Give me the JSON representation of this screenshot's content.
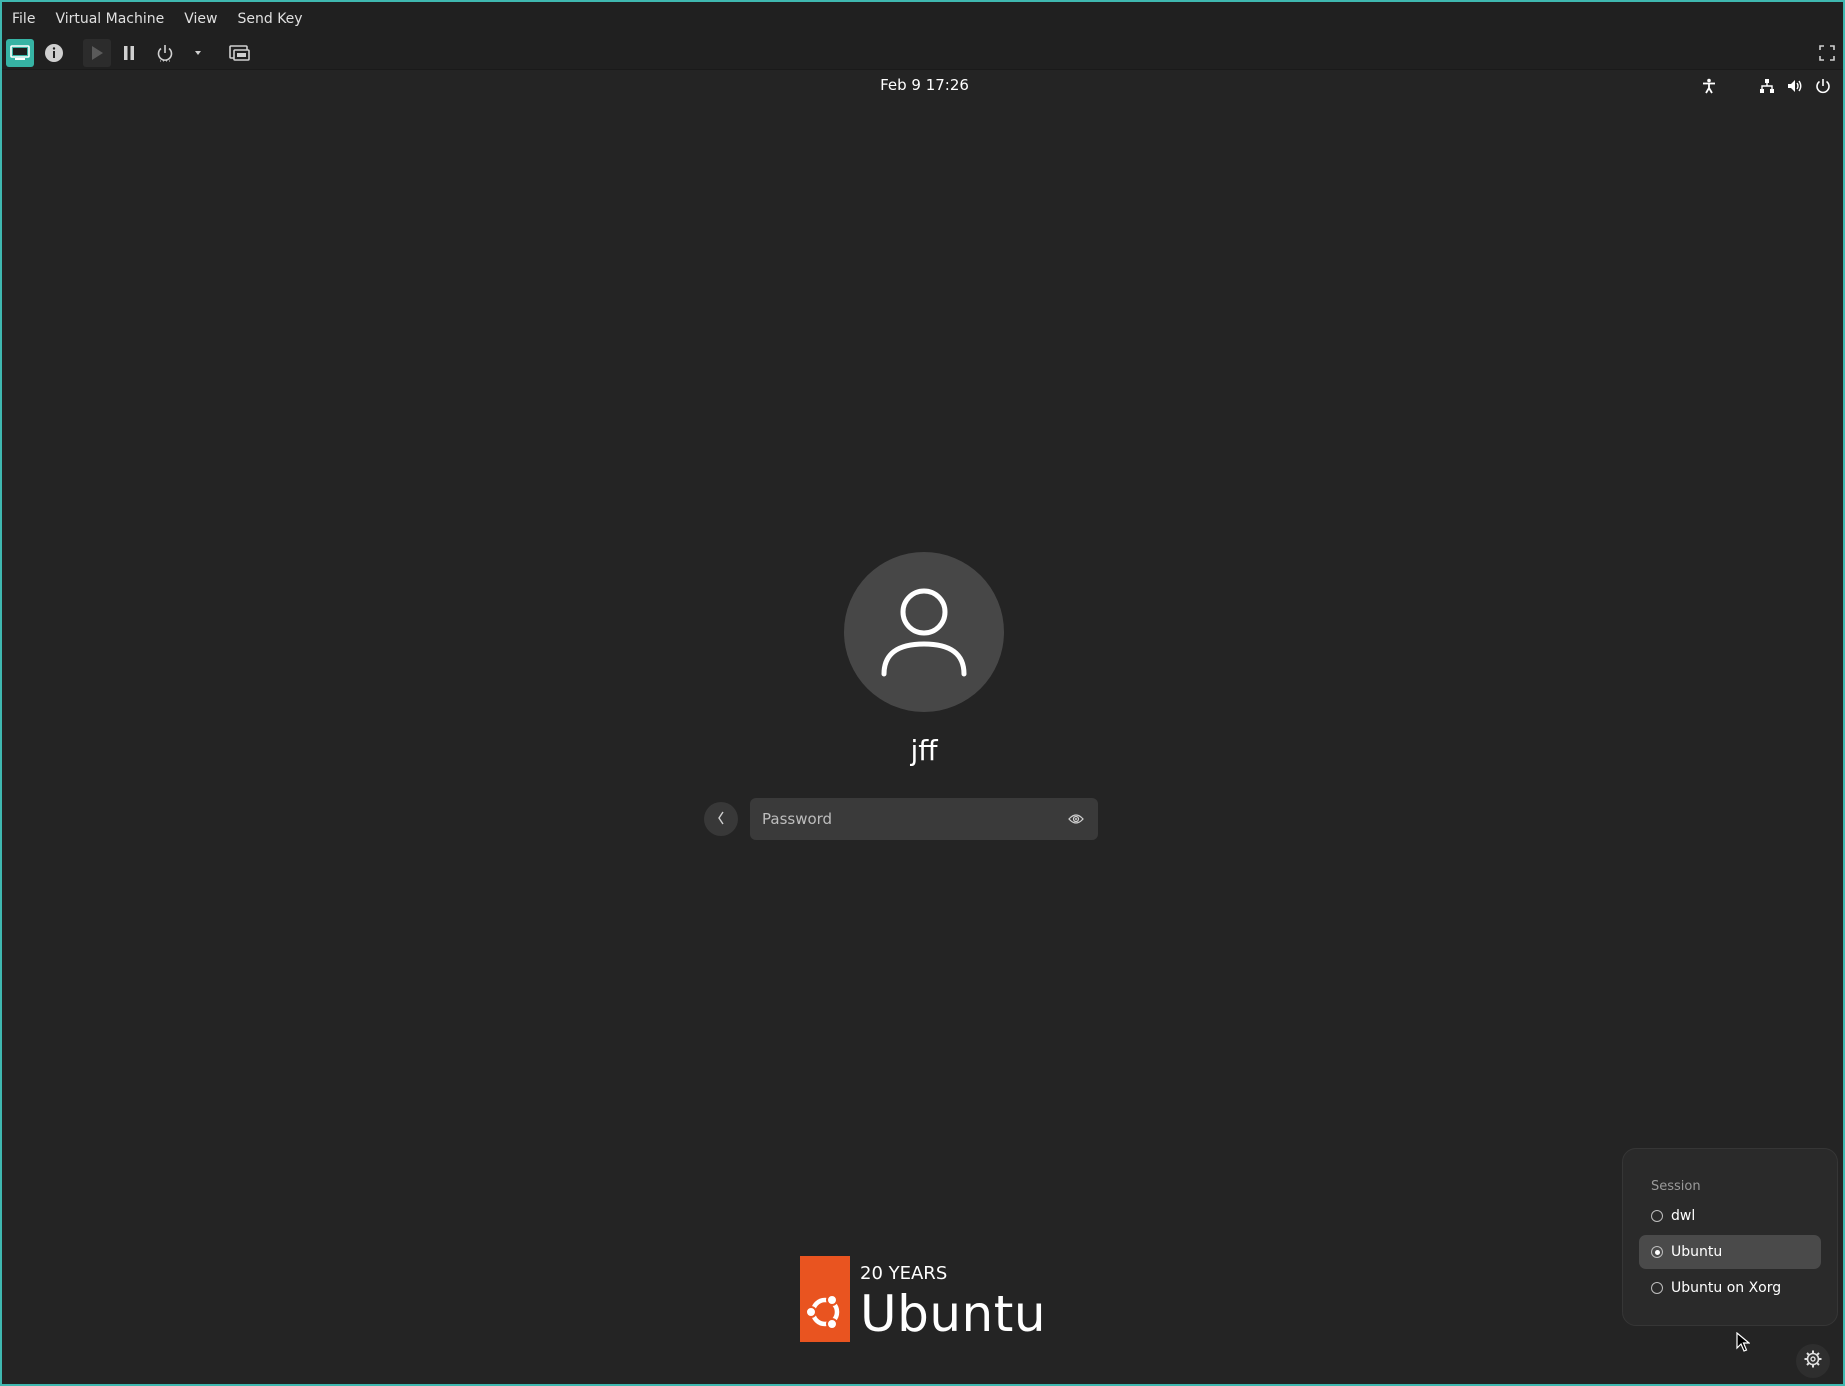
{
  "menubar": {
    "items": [
      "File",
      "Virtual Machine",
      "View",
      "Send Key"
    ]
  },
  "toolbar": {
    "buttons": [
      {
        "name": "console-view",
        "icon": "monitor-icon",
        "active": true
      },
      {
        "name": "details-view",
        "icon": "info-icon",
        "active": false
      },
      {
        "name": "run",
        "icon": "play-icon",
        "active": false
      },
      {
        "name": "pause",
        "icon": "pause-icon",
        "active": false
      },
      {
        "name": "shutdown",
        "icon": "power-icon",
        "active": false
      },
      {
        "name": "shutdown-menu",
        "icon": "dropdown-arrow-icon",
        "active": false
      },
      {
        "name": "snapshots",
        "icon": "snapshots-icon",
        "active": false
      },
      {
        "name": "fullscreen",
        "icon": "fullscreen-icon",
        "active": false
      }
    ]
  },
  "guest": {
    "clock": "Feb 9  17:26",
    "system_icons": [
      "accessibility-icon",
      "network-icon",
      "volume-icon",
      "power-icon"
    ],
    "login": {
      "username": "jff",
      "password_placeholder": "Password",
      "password_value": ""
    },
    "branding": {
      "years": "20 YEARS",
      "name": "Ubuntu",
      "color": "#e95420"
    },
    "session_menu": {
      "title": "Session",
      "options": [
        {
          "label": "dwl",
          "selected": false
        },
        {
          "label": "Ubuntu",
          "selected": true
        },
        {
          "label": "Ubuntu on Xorg",
          "selected": false
        }
      ]
    }
  },
  "colors": {
    "accent": "#36b3a4",
    "background": "#242424",
    "ubuntu_orange": "#e95420"
  }
}
